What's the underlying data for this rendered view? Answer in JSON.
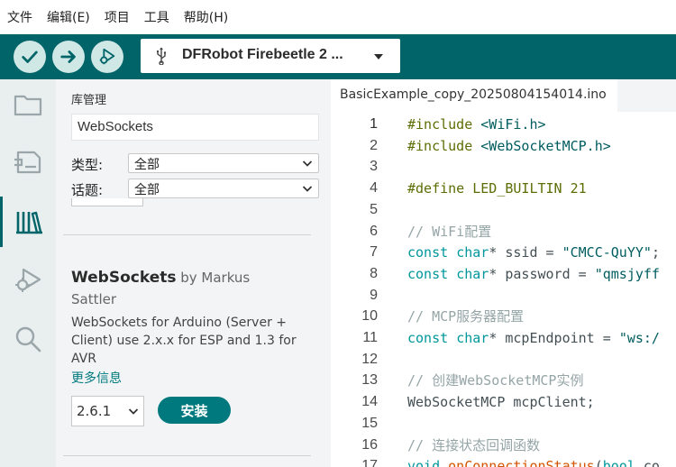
{
  "menubar": {
    "items": [
      "文件",
      "编辑(E)",
      "项目",
      "工具",
      "帮助(H)"
    ]
  },
  "toolbar": {
    "verify_icon": "check-icon",
    "upload_icon": "arrow-right-icon",
    "debug_icon": "debug-icon",
    "board_label": "DFRobot Firebeetle 2 ...",
    "accent": "#006468"
  },
  "rail": {
    "items": [
      "folder-icon",
      "board-icon",
      "library-icon",
      "debug-icon",
      "search-icon"
    ],
    "active_index": 2
  },
  "library_manager": {
    "title": "库管理",
    "search_value": "WebSockets",
    "filters": [
      {
        "label": "类型:",
        "value": "全部"
      },
      {
        "label": "话题:",
        "value": "全部"
      }
    ],
    "result": {
      "name": "WebSockets",
      "by_prefix": " by Markus",
      "author_rest": "Sattler",
      "description": "WebSockets for Arduino (Server + Client) use 2.x.x for ESP and 1.3 for AVR",
      "more_info": "更多信息",
      "version": "2.6.1",
      "install_label": "安装"
    }
  },
  "editor": {
    "tab_name": "BasicExample_copy_20250804154014.ino",
    "active_line": 1,
    "lines": [
      {
        "n": "1",
        "tokens": [
          {
            "t": "#include ",
            "c": "pre"
          },
          {
            "t": "<WiFi.h>",
            "c": "str"
          }
        ]
      },
      {
        "n": "2",
        "tokens": [
          {
            "t": "#include ",
            "c": "pre"
          },
          {
            "t": "<WebSocketMCP.h>",
            "c": "str"
          }
        ]
      },
      {
        "n": "3",
        "tokens": []
      },
      {
        "n": "4",
        "tokens": [
          {
            "t": "#define ",
            "c": "pre"
          },
          {
            "t": "LED_BUILTIN 21",
            "c": "pre"
          }
        ]
      },
      {
        "n": "5",
        "tokens": []
      },
      {
        "n": "6",
        "tokens": [
          {
            "t": "// WiFi配置",
            "c": "com"
          }
        ]
      },
      {
        "n": "7",
        "tokens": [
          {
            "t": "const ",
            "c": "kw"
          },
          {
            "t": "char",
            "c": "kw"
          },
          {
            "t": "* ssid = ",
            "c": "num"
          },
          {
            "t": "\"CMCC-QuYY\"",
            "c": "str"
          },
          {
            "t": ";",
            "c": "num"
          }
        ]
      },
      {
        "n": "8",
        "tokens": [
          {
            "t": "const ",
            "c": "kw"
          },
          {
            "t": "char",
            "c": "kw"
          },
          {
            "t": "* password = ",
            "c": "num"
          },
          {
            "t": "\"qmsjyff",
            "c": "str"
          }
        ]
      },
      {
        "n": "9",
        "tokens": []
      },
      {
        "n": "10",
        "tokens": [
          {
            "t": "// MCP服务器配置",
            "c": "com"
          }
        ]
      },
      {
        "n": "11",
        "tokens": [
          {
            "t": "const ",
            "c": "kw"
          },
          {
            "t": "char",
            "c": "kw"
          },
          {
            "t": "* mcpEndpoint = ",
            "c": "num"
          },
          {
            "t": "\"ws:/",
            "c": "str"
          }
        ]
      },
      {
        "n": "12",
        "tokens": []
      },
      {
        "n": "13",
        "tokens": [
          {
            "t": "// 创建WebSocketMCP实例",
            "c": "com"
          }
        ]
      },
      {
        "n": "14",
        "tokens": [
          {
            "t": "WebSocketMCP mcpClient;",
            "c": "num"
          }
        ]
      },
      {
        "n": "15",
        "tokens": []
      },
      {
        "n": "16",
        "tokens": [
          {
            "t": "// 连接状态回调函数",
            "c": "com"
          }
        ]
      },
      {
        "n": "17",
        "tokens": [
          {
            "t": "void ",
            "c": "kw"
          },
          {
            "t": "onConnectionStatus",
            "c": "fn"
          },
          {
            "t": "(",
            "c": "num"
          },
          {
            "t": "bool",
            "c": "kw"
          },
          {
            "t": " co",
            "c": "num"
          }
        ]
      }
    ]
  }
}
